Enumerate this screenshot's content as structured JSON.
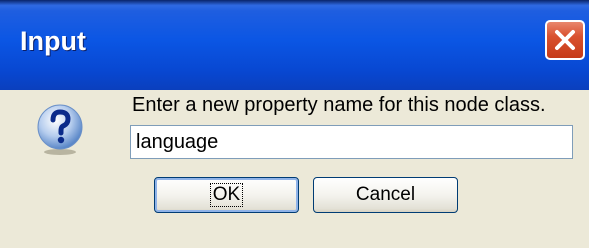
{
  "window": {
    "title": "Input"
  },
  "icons": {
    "close": "close-icon",
    "dialog": "question-icon"
  },
  "dialog": {
    "message": "Enter a new property name for this node class.",
    "input_value": "language"
  },
  "buttons": {
    "ok": "OK",
    "cancel": "Cancel"
  },
  "colors": {
    "titlebar": "#0b56e4",
    "close": "#d9512f",
    "body": "#ece9d8"
  }
}
